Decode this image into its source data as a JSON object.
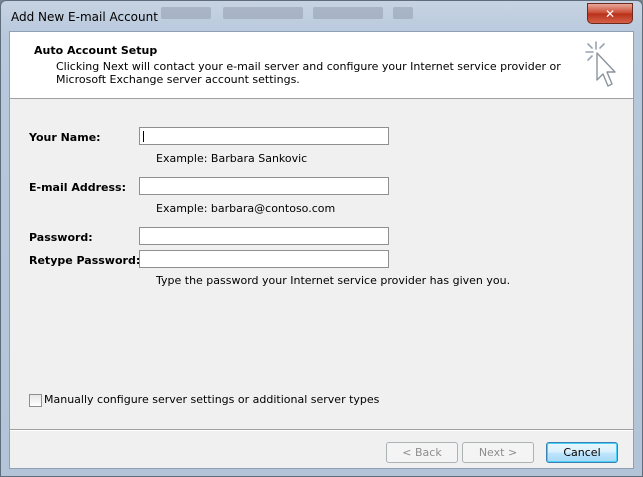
{
  "window": {
    "title": "Add New E-mail Account",
    "close_glyph": "✕"
  },
  "header": {
    "title": "Auto Account Setup",
    "description": "Clicking Next will contact your e-mail server and configure your Internet service provider or Microsoft Exchange server account settings.",
    "icon": "cursor-click-icon"
  },
  "form": {
    "name_label": "Your Name:",
    "name_value": "",
    "name_example": "Example: Barbara Sankovic",
    "email_label": "E-mail Address:",
    "email_value": "",
    "email_example": "Example: barbara@contoso.com",
    "password_label": "Password:",
    "password_value": "",
    "retype_label": "Retype Password:",
    "retype_value": "",
    "password_hint": "Type the password your Internet service provider has given you."
  },
  "manual_config": {
    "label": "Manually configure server settings or additional server types",
    "checked": false
  },
  "buttons": {
    "back": "< Back",
    "next": "Next >",
    "cancel": "Cancel"
  },
  "colors": {
    "accent": "#3c7fb1",
    "close": "#c8452e"
  }
}
